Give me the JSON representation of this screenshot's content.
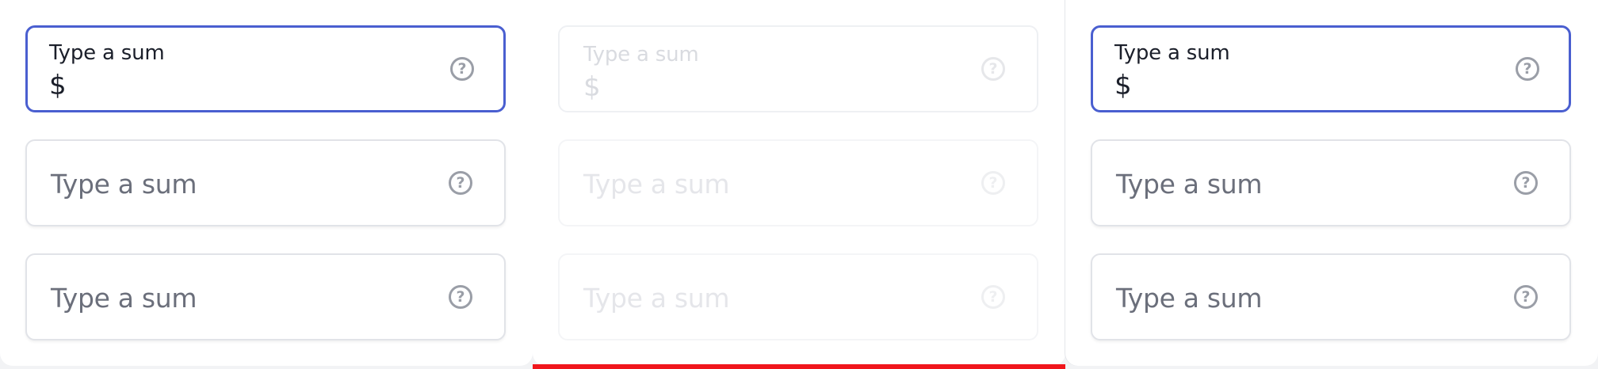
{
  "columns": [
    {
      "state": "enabled",
      "fields": [
        {
          "label": "Type a sum",
          "prefix": "$",
          "help_icon": "question-circle-icon",
          "focused": true
        },
        {
          "placeholder": "Type a sum",
          "help_icon": "question-circle-icon"
        },
        {
          "placeholder": "Type a sum",
          "help_icon": "question-circle-icon"
        }
      ]
    },
    {
      "state": "disabled",
      "fields": [
        {
          "label": "Type a sum",
          "prefix": "$",
          "help_icon": "question-circle-icon"
        },
        {
          "placeholder": "Type a sum",
          "help_icon": "question-circle-icon"
        },
        {
          "placeholder": "Type a sum",
          "help_icon": "question-circle-icon"
        }
      ]
    },
    {
      "state": "enabled",
      "fields": [
        {
          "label": "Type a sum",
          "prefix": "$",
          "help_icon": "question-circle-icon",
          "focused": true
        },
        {
          "placeholder": "Type a sum",
          "help_icon": "question-circle-icon"
        },
        {
          "placeholder": "Type a sum",
          "help_icon": "question-circle-icon"
        }
      ]
    }
  ],
  "help_glyph": "?",
  "colors": {
    "focus_border": "#4a5fd0",
    "default_border": "#e1e3e8",
    "placeholder": "#6b6f7b",
    "icon": "#9a9ea7",
    "error_bar": "#f0161c"
  }
}
